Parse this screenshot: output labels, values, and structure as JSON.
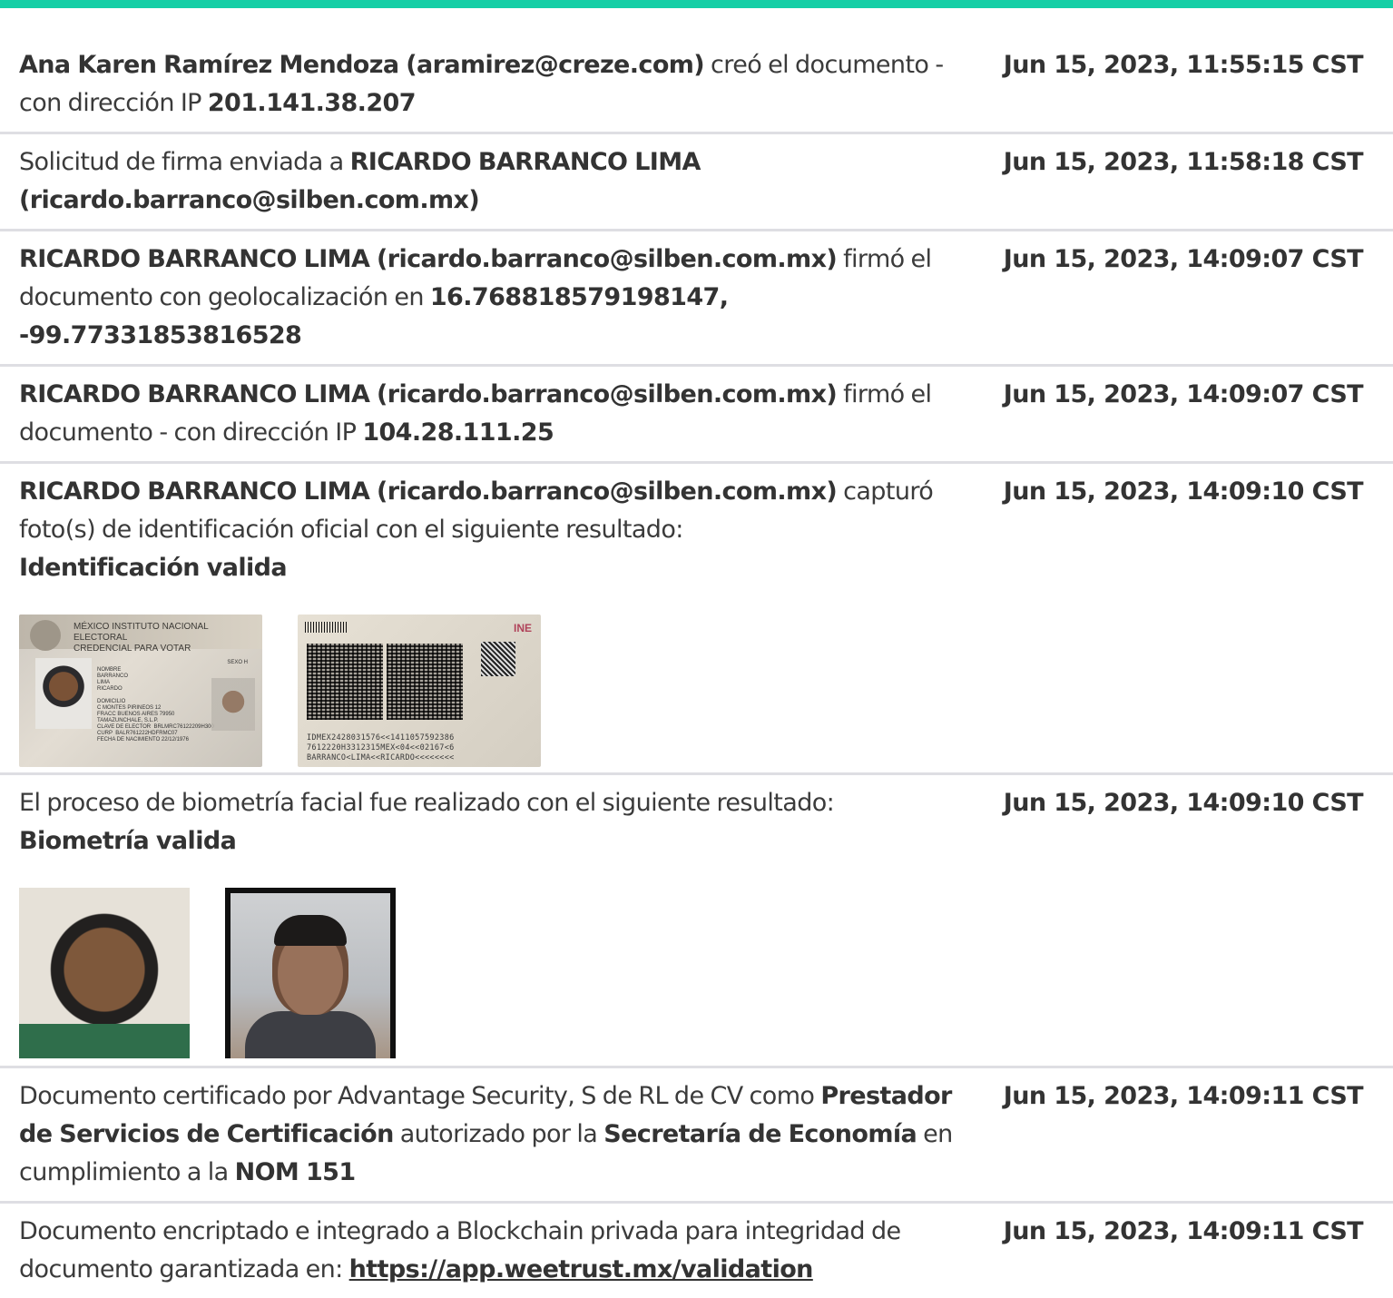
{
  "colors": {
    "accent": "#15cfa6",
    "text": "#333333",
    "divider": "#dedee3"
  },
  "rows": [
    {
      "actor": "Ana Karen Ramírez Mendoza (aramirez@creze.com)",
      "text1": " creó el documento - con dirección IP ",
      "ip": "201.141.38.207",
      "timestamp": "Jun 15, 2023, 11:55:15 CST"
    },
    {
      "text1": "Solicitud de firma enviada a ",
      "recipient": "RICARDO BARRANCO LIMA (ricardo.barranco@silben.com.mx)",
      "timestamp": "Jun 15, 2023, 11:58:18 CST"
    },
    {
      "actor": "RICARDO BARRANCO LIMA (ricardo.barranco@silben.com.mx)",
      "text1": " firmó el documento con geolocalización en ",
      "geo": "16.768818579198147, -99.77331853816528",
      "timestamp": "Jun 15, 2023, 14:09:07 CST"
    },
    {
      "actor": "RICARDO BARRANCO LIMA (ricardo.barranco@silben.com.mx)",
      "text1": " firmó el documento - con dirección IP ",
      "ip": "104.28.111.25",
      "timestamp": "Jun 15, 2023, 14:09:07 CST"
    },
    {
      "actor": "RICARDO BARRANCO LIMA (ricardo.barranco@silben.com.mx)",
      "text1": " capturó foto(s) de identificación oficial con el siguiente resultado:",
      "result": "Identificación valida",
      "timestamp": "Jun 15, 2023, 14:09:10 CST",
      "id_front": {
        "country": "MÉXICO",
        "institution": "INSTITUTO NACIONAL ELECTORAL",
        "doc": "CREDENCIAL PARA VOTAR",
        "details": "NOMBRE\nBARRANCO\nLIMA\nRICARDO\n\nDOMICILIO\nC MONTES PIRINEOS 12\nFRACC BUENOS AIRES 79950\nTAMAZUNCHALE, S.L.P.\nCLAVE DE ELECTOR  BRLMRC76122209H300\nCURP  BALR761222HDFRMC07\nFECHA DE NACIMIENTO 22/12/1976",
        "sex": "SEXO H"
      },
      "id_back": {
        "brand": "INE",
        "mrz": "IDMEX2428031576<<1411057592386\n7612220H3312315MEX<04<<02167<6\nBARRANCO<LIMA<<RICARDO<<<<<<<<"
      }
    },
    {
      "text1": "El proceso de biometría facial fue realizado con el siguiente resultado:",
      "result": "Biometría valida",
      "timestamp": "Jun 15, 2023, 14:09:10 CST"
    },
    {
      "text1": "Documento certificado por Advantage Security, S de RL de CV como ",
      "b1": "Prestador de Servicios de Certificación",
      "text2": " autorizado por la ",
      "b2": "Secretaría de Economía",
      "text3": " en cumplimiento a la ",
      "b3": "NOM 151",
      "timestamp": "Jun 15, 2023, 14:09:11 CST"
    },
    {
      "text1": "Documento encriptado e integrado a Blockchain privada para integridad de documento garantizada en: ",
      "link": "https://app.weetrust.mx/validation",
      "timestamp": "Jun 15, 2023, 14:09:11 CST"
    }
  ]
}
